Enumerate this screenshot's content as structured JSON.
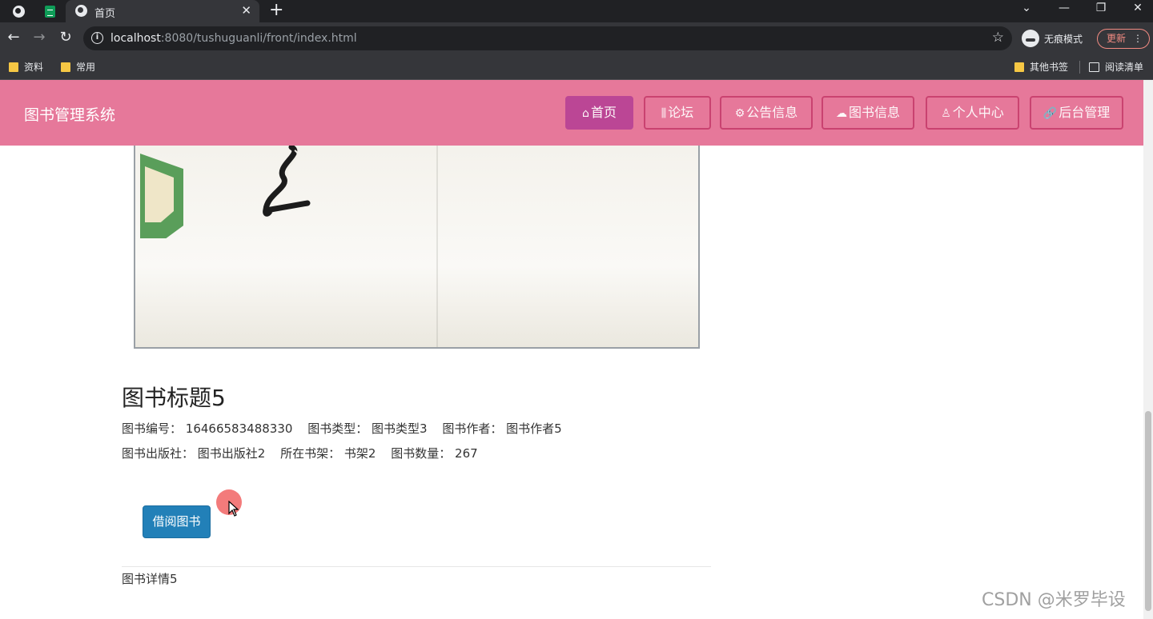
{
  "browser": {
    "tab_title": "首页",
    "url_host": "localhost",
    "url_rest": ":8080/tushuguanli/front/index.html",
    "incognito_label": "无痕模式",
    "update_label": "更新",
    "bookmarks": [
      "资料",
      "常用"
    ],
    "other_bookmarks": "其他书签",
    "reading_list": "阅读清单"
  },
  "site": {
    "brand": "图书管理系统",
    "nav": [
      {
        "label": "首页",
        "icon": "home-icon",
        "glyph": "⌂"
      },
      {
        "label": "论坛",
        "icon": "forum-icon",
        "glyph": "⫼"
      },
      {
        "label": "公告信息",
        "icon": "gear-icon",
        "glyph": "⚙"
      },
      {
        "label": "图书信息",
        "icon": "cloud-icon",
        "glyph": "☁"
      },
      {
        "label": "个人中心",
        "icon": "user-icon",
        "glyph": "♙"
      },
      {
        "label": "后台管理",
        "icon": "link-icon",
        "glyph": "🔗"
      }
    ]
  },
  "book": {
    "title": "图书标题5",
    "number_label": "图书编号：",
    "number": "16466583488330",
    "type_label": "图书类型：",
    "type": "图书类型3",
    "author_label": "图书作者：",
    "author": "图书作者5",
    "publisher_label": "图书出版社：",
    "publisher": "图书出版社2",
    "shelf_label": "所在书架：",
    "shelf": "书架2",
    "count_label": "图书数量：",
    "count": "267",
    "borrow_label": "借阅图书",
    "detail": "图书详情5"
  },
  "watermark": "CSDN @米罗毕设",
  "colors": {
    "header": "#e6789a",
    "active_nav": "#b94495",
    "borrow_button": "#2280b8"
  }
}
